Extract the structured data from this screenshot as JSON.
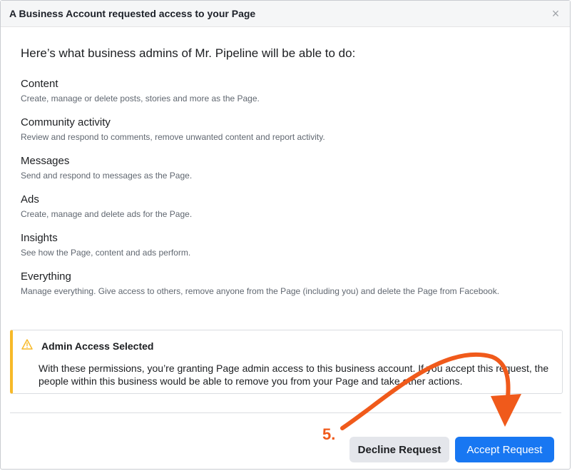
{
  "dialog": {
    "title": "A Business Account requested access to your Page",
    "close_glyph": "×",
    "intro": "Here’s what business admins of Mr. Pipeline will be able to do:",
    "permissions": [
      {
        "title": "Content",
        "desc": "Create, manage or delete posts, stories and more as the Page."
      },
      {
        "title": "Community activity",
        "desc": "Review and respond to comments, remove unwanted content and report activity."
      },
      {
        "title": "Messages",
        "desc": "Send and respond to messages as the Page."
      },
      {
        "title": "Ads",
        "desc": "Create, manage and delete ads for the Page."
      },
      {
        "title": "Insights",
        "desc": "See how the Page, content and ads perform."
      },
      {
        "title": "Everything",
        "desc": "Manage everything. Give access to others, remove anyone from the Page (including you) and delete the Page from Facebook."
      }
    ],
    "alert": {
      "icon": "warning-triangle-icon",
      "title": "Admin Access Selected",
      "text": "With these permissions, you’re granting Page admin access to this business account. If you accept this request, the people within this business would be able to remove you from your Page and take other actions."
    },
    "buttons": {
      "decline": "Decline Request",
      "accept": "Accept Request"
    }
  },
  "annotation": {
    "step_label": "5.",
    "color": "#f05a1b"
  },
  "colors": {
    "accent": "#1877f2",
    "warning": "#f7b928",
    "muted_text": "#606770"
  }
}
